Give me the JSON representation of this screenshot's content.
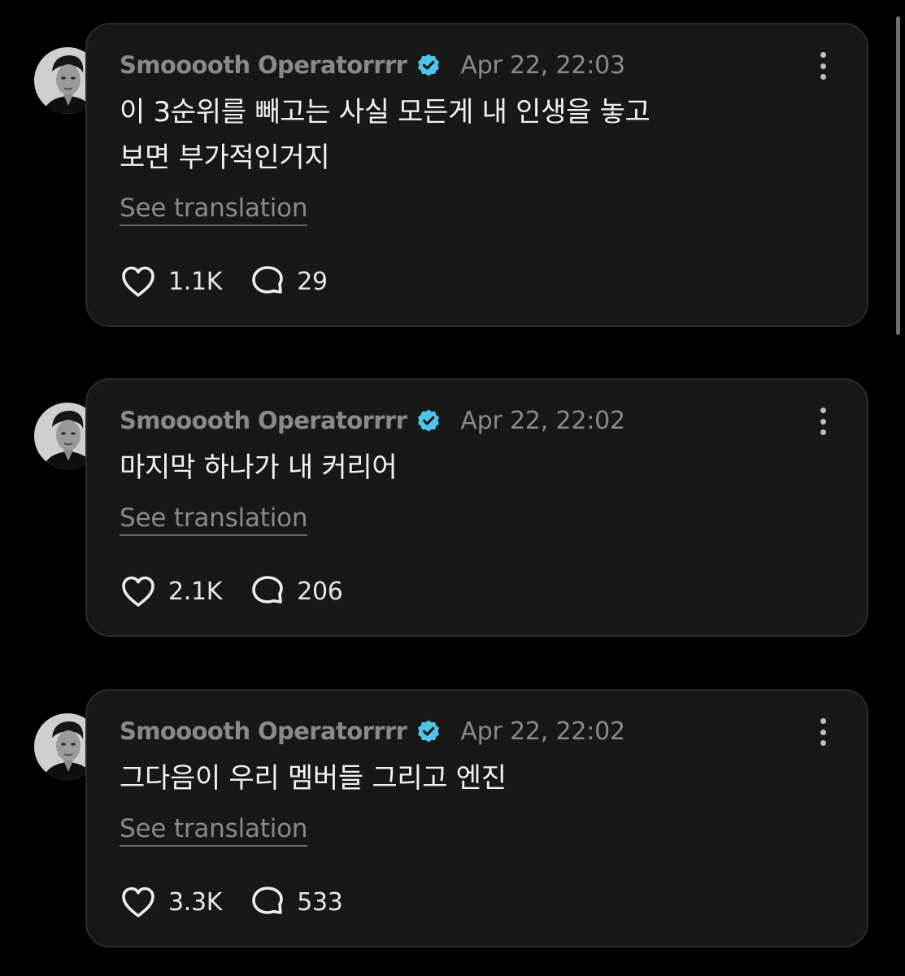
{
  "colors": {
    "background": "#000000",
    "card": "#181818",
    "card_border": "#2b2b2b",
    "muted_text": "#8a8a8a",
    "body_text": "#f2f2f2",
    "verified_badge": "#4fc3e8"
  },
  "posts": [
    {
      "username": "Smooooth Operatorrrr",
      "verified": true,
      "timestamp": "Apr 22, 22:03",
      "text": "이 3순위를 빼고는 사실 모든게 내 인생을 놓고\n보면 부가적인거지",
      "translation_label": "See translation",
      "likes": "1.1K",
      "replies": "29",
      "icons": [
        "avatar",
        "verified-badge-icon",
        "more-options-icon",
        "heart-icon",
        "comment-icon"
      ]
    },
    {
      "username": "Smooooth Operatorrrr",
      "verified": true,
      "timestamp": "Apr 22, 22:02",
      "text": "마지막 하나가 내 커리어",
      "translation_label": "See translation",
      "likes": "2.1K",
      "replies": "206",
      "icons": [
        "avatar",
        "verified-badge-icon",
        "more-options-icon",
        "heart-icon",
        "comment-icon"
      ]
    },
    {
      "username": "Smooooth Operatorrrr",
      "verified": true,
      "timestamp": "Apr 22, 22:02",
      "text": "그다음이 우리 멤버들 그리고 엔진",
      "translation_label": "See translation",
      "likes": "3.3K",
      "replies": "533",
      "icons": [
        "avatar",
        "verified-badge-icon",
        "more-options-icon",
        "heart-icon",
        "comment-icon"
      ]
    }
  ]
}
